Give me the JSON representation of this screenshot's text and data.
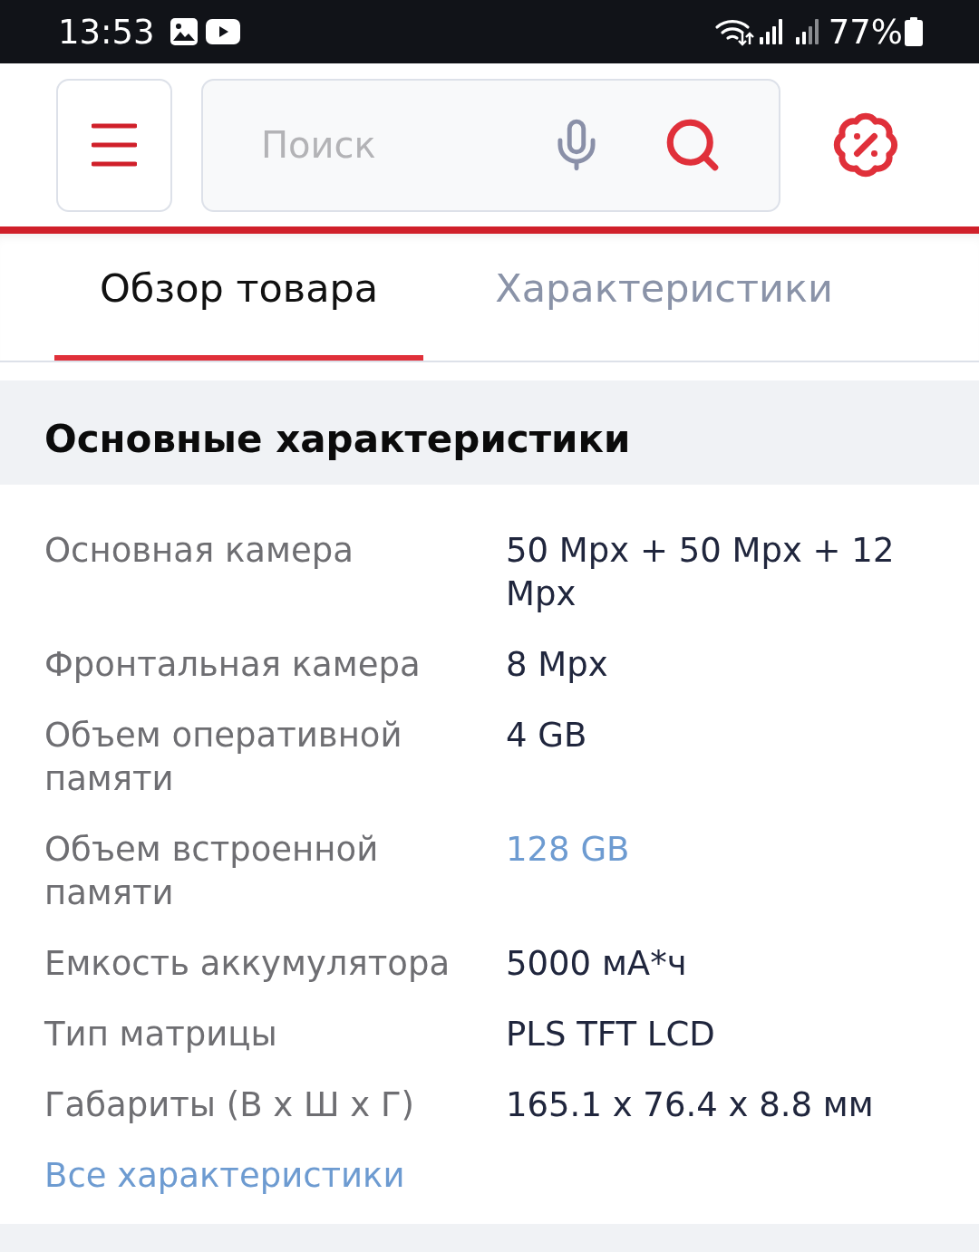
{
  "status_bar": {
    "time": "13:53",
    "battery": "77%"
  },
  "header": {
    "search": {
      "placeholder": "Поиск"
    }
  },
  "tabs": [
    {
      "label": "Обзор товара",
      "selected": true
    },
    {
      "label": "Характеристики",
      "selected": false
    }
  ],
  "specs": {
    "title": "Основные характеристики",
    "rows": [
      {
        "label": "Основная камера",
        "value": "50 Mpx + 50 Mpx + 12 Mpx",
        "kind": "text"
      },
      {
        "label": "Фронтальная камера",
        "value": "8 Mpx",
        "kind": "text"
      },
      {
        "label": "Объем оперативной памяти",
        "value": "4 GB",
        "kind": "text"
      },
      {
        "label": "Объем встроенной памяти",
        "value": "128 GB",
        "kind": "link"
      },
      {
        "label": "Емкость аккумулятора",
        "value": "5000 мА*ч",
        "kind": "text"
      },
      {
        "label": "Тип матрицы",
        "value": "PLS TFT LCD",
        "kind": "text"
      },
      {
        "label": "Габариты (В x Ш x Г)",
        "value": "165.1 x 76.4 x 8.8 мм",
        "kind": "text"
      }
    ],
    "all_link": "Все характеристики"
  }
}
